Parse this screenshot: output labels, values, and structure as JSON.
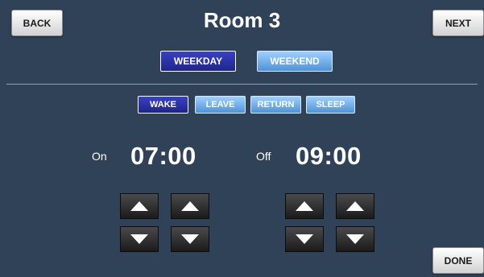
{
  "title": "Room 3",
  "nav": {
    "back": "BACK",
    "next": "NEXT",
    "done": "DONE"
  },
  "day_tabs": [
    {
      "label": "WEEKDAY",
      "active": true
    },
    {
      "label": "WEEKEND",
      "active": false
    }
  ],
  "events": [
    {
      "label": "WAKE",
      "active": true
    },
    {
      "label": "LEAVE",
      "active": false
    },
    {
      "label": "RETURN",
      "active": false
    },
    {
      "label": "SLEEP",
      "active": false
    }
  ],
  "schedule": {
    "on_label": "On",
    "on_time": "07:00",
    "off_label": "Off",
    "off_time": "09:00"
  },
  "icons": [
    "up-arrow-icon",
    "down-arrow-icon"
  ],
  "colors": {
    "background": "#2f4257",
    "active_tab": "#2a30a8",
    "inactive_tab": "#6aa8e8",
    "text": "#ffffff"
  }
}
